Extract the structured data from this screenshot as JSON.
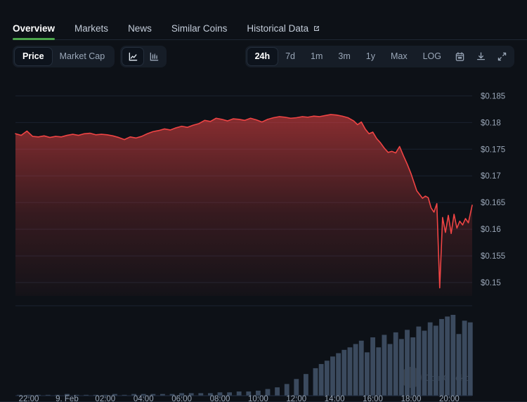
{
  "theme": {
    "background": "#0d1117",
    "accent_green": "#4ca64c",
    "line_color": "#ef4444",
    "volume_color": "#3b4a5e",
    "text_muted": "#9aa7b8"
  },
  "tabs": [
    {
      "label": "Overview",
      "active": true,
      "external": false
    },
    {
      "label": "Markets",
      "active": false,
      "external": false
    },
    {
      "label": "News",
      "active": false,
      "external": false
    },
    {
      "label": "Similar Coins",
      "active": false,
      "external": false
    },
    {
      "label": "Historical Data",
      "active": false,
      "external": true
    }
  ],
  "toolbar": {
    "metric_options": [
      {
        "label": "Price",
        "active": true
      },
      {
        "label": "Market Cap",
        "active": false
      }
    ],
    "chart_type_icons": [
      {
        "name": "line-chart-icon",
        "active": true
      },
      {
        "name": "candlestick-chart-icon",
        "active": false
      }
    ],
    "ranges": [
      {
        "label": "24h",
        "active": true
      },
      {
        "label": "7d",
        "active": false
      },
      {
        "label": "1m",
        "active": false
      },
      {
        "label": "3m",
        "active": false
      },
      {
        "label": "1y",
        "active": false
      },
      {
        "label": "Max",
        "active": false
      },
      {
        "label": "LOG",
        "active": false
      }
    ],
    "action_icons": [
      {
        "name": "calendar-icon"
      },
      {
        "name": "download-icon"
      },
      {
        "name": "fullscreen-icon"
      }
    ]
  },
  "watermark": {
    "text": "CoinGecko"
  },
  "chart_data": {
    "type": "line",
    "title": "",
    "xlabel": "",
    "ylabel": "",
    "grid": true,
    "legend": "none",
    "ylim": [
      0.1475,
      0.1865
    ],
    "y_ticks": [
      "$0.185",
      "$0.18",
      "$0.175",
      "$0.17",
      "$0.165",
      "$0.16",
      "$0.155",
      "$0.15"
    ],
    "y_tick_values": [
      0.185,
      0.18,
      0.175,
      0.17,
      0.165,
      0.16,
      0.155,
      0.15
    ],
    "x_ticks": [
      "22:00",
      "9. Feb",
      "02:00",
      "04:00",
      "06:00",
      "08:00",
      "10:00",
      "12:00",
      "14:00",
      "16:00",
      "18:00",
      "20:00"
    ],
    "x_tick_hours": [
      22,
      24,
      26,
      28,
      30,
      32,
      34,
      36,
      38,
      40,
      42,
      44
    ],
    "xlim_hours": [
      21.3,
      45.2
    ],
    "series": [
      {
        "name": "Price",
        "color": "#ef4444",
        "fill": "gradient-red",
        "x": [
          21.3,
          21.6,
          21.9,
          22.2,
          22.5,
          22.8,
          23.1,
          23.4,
          23.7,
          24.0,
          24.3,
          24.6,
          24.9,
          25.2,
          25.5,
          25.8,
          26.1,
          26.4,
          26.7,
          27.0,
          27.3,
          27.6,
          27.9,
          28.2,
          28.5,
          28.8,
          29.1,
          29.4,
          29.7,
          30.0,
          30.3,
          30.6,
          30.9,
          31.2,
          31.5,
          31.8,
          32.1,
          32.4,
          32.7,
          33.0,
          33.3,
          33.6,
          33.9,
          34.2,
          34.5,
          34.8,
          35.1,
          35.4,
          35.7,
          36.0,
          36.3,
          36.6,
          36.9,
          37.2,
          37.5,
          37.8,
          38.1,
          38.4,
          38.7,
          39.0,
          39.2,
          39.4,
          39.6,
          39.8,
          40.0,
          40.2,
          40.4,
          40.6,
          40.8,
          41.0,
          41.2,
          41.4,
          41.6,
          41.8,
          42.0,
          42.15,
          42.3,
          42.45,
          42.6,
          42.75,
          42.9,
          43.05,
          43.2,
          43.35,
          43.5,
          43.65,
          43.8,
          43.95,
          44.1,
          44.25,
          44.4,
          44.55,
          44.7,
          44.85,
          45.0,
          45.2
        ],
        "y": [
          0.1779,
          0.1776,
          0.1784,
          0.1774,
          0.1773,
          0.1775,
          0.1772,
          0.1774,
          0.1773,
          0.1776,
          0.1778,
          0.1776,
          0.1779,
          0.178,
          0.1777,
          0.1778,
          0.1777,
          0.1775,
          0.1772,
          0.1768,
          0.1773,
          0.1771,
          0.1774,
          0.1779,
          0.1783,
          0.1785,
          0.1788,
          0.1786,
          0.179,
          0.1793,
          0.1791,
          0.1795,
          0.1798,
          0.1804,
          0.1802,
          0.1808,
          0.1806,
          0.1803,
          0.1807,
          0.1806,
          0.1804,
          0.1808,
          0.1805,
          0.1801,
          0.1806,
          0.1809,
          0.1811,
          0.181,
          0.1808,
          0.1809,
          0.1811,
          0.181,
          0.1812,
          0.1811,
          0.1813,
          0.1815,
          0.1814,
          0.1812,
          0.1809,
          0.1803,
          0.1796,
          0.1801,
          0.1788,
          0.1779,
          0.1782,
          0.177,
          0.1762,
          0.1752,
          0.1744,
          0.1746,
          0.1743,
          0.1755,
          0.1738,
          0.1722,
          0.1704,
          0.1688,
          0.1672,
          0.1665,
          0.1658,
          0.1662,
          0.1659,
          0.164,
          0.1632,
          0.1648,
          0.149,
          0.1622,
          0.1594,
          0.1626,
          0.1592,
          0.1628,
          0.1602,
          0.1615,
          0.1608,
          0.162,
          0.1612,
          0.1645
        ]
      }
    ],
    "volume": {
      "name": "Volume",
      "color": "#3b4a5e",
      "x": [
        21.5,
        22.0,
        22.5,
        23.0,
        23.5,
        24.0,
        24.5,
        25.0,
        25.5,
        26.0,
        26.5,
        27.0,
        27.5,
        28.0,
        28.5,
        29.0,
        29.5,
        30.0,
        30.5,
        31.0,
        31.5,
        32.0,
        32.5,
        33.0,
        33.5,
        34.0,
        34.5,
        35.0,
        35.5,
        36.0,
        36.5,
        37.0,
        37.3,
        37.6,
        37.9,
        38.2,
        38.5,
        38.8,
        39.1,
        39.4,
        39.7,
        40.0,
        40.3,
        40.6,
        40.9,
        41.2,
        41.5,
        41.8,
        42.1,
        42.4,
        42.7,
        43.0,
        43.3,
        43.6,
        43.9,
        44.2,
        44.5,
        44.8,
        45.1
      ],
      "values": [
        0.01,
        0.01,
        0.01,
        0.01,
        0.01,
        0.02,
        0.01,
        0.01,
        0.01,
        0.01,
        0.02,
        0.01,
        0.02,
        0.02,
        0.02,
        0.02,
        0.02,
        0.03,
        0.03,
        0.03,
        0.03,
        0.04,
        0.04,
        0.05,
        0.05,
        0.06,
        0.08,
        0.1,
        0.14,
        0.2,
        0.26,
        0.33,
        0.38,
        0.42,
        0.47,
        0.51,
        0.55,
        0.58,
        0.62,
        0.66,
        0.52,
        0.7,
        0.58,
        0.73,
        0.62,
        0.76,
        0.68,
        0.79,
        0.7,
        0.83,
        0.78,
        0.88,
        0.84,
        0.92,
        0.95,
        0.97,
        0.74,
        0.9,
        0.88
      ]
    }
  }
}
